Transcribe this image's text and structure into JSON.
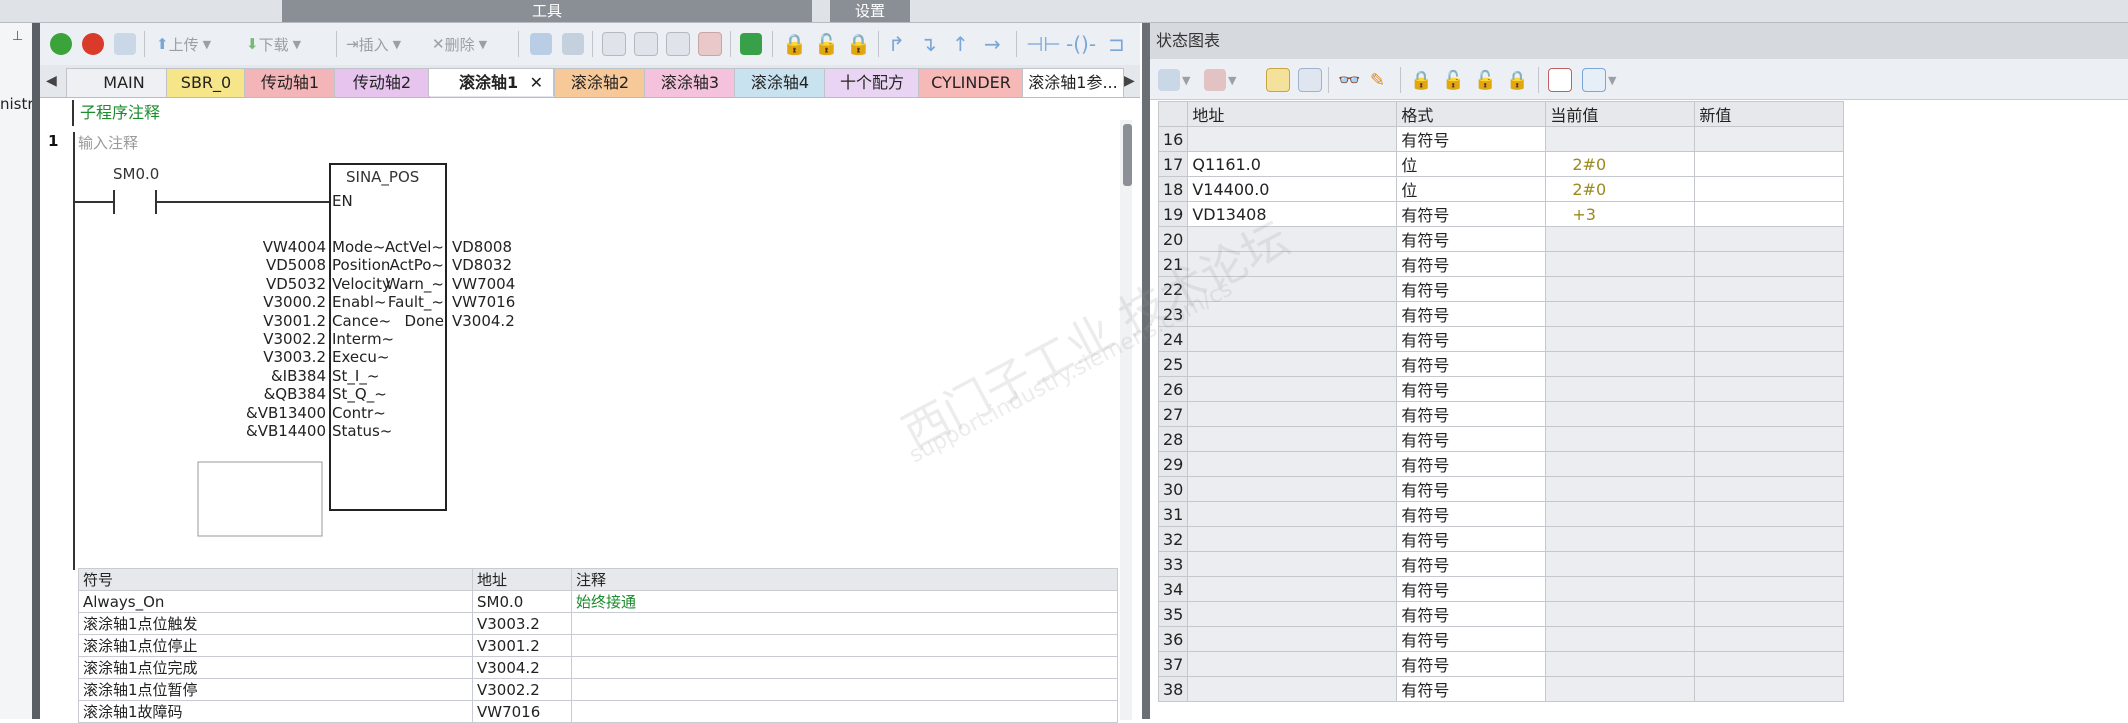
{
  "menu": {
    "tools_label": "工具",
    "settings_label": "设置"
  },
  "left": {
    "partial_text": "nistra"
  },
  "toolbar": {
    "upload_label": "上传",
    "download_label": "下载",
    "insert_label": "插入",
    "delete_label": "删除"
  },
  "tabs": [
    {
      "label": "MAIN",
      "color": "#eef0f3"
    },
    {
      "label": "SBR_0",
      "color": "#f7e58a"
    },
    {
      "label": "传动轴1",
      "color": "#f4b5b8"
    },
    {
      "label": "传动轴2",
      "color": "#e6c4ee"
    },
    {
      "label": "滚涂轴1",
      "color": "#ffffff"
    },
    {
      "label": "滚涂轴2",
      "color": "#f8c998"
    },
    {
      "label": "滚涂轴3",
      "color": "#f4c2dc"
    },
    {
      "label": "滚涂轴4",
      "color": "#c8e2ef"
    },
    {
      "label": "十个配方",
      "color": "#e9d5f3"
    },
    {
      "label": "CYLINDER",
      "color": "#f7b8b8"
    },
    {
      "label": "滚涂轴1参...",
      "color": "#ffffff"
    }
  ],
  "editor": {
    "subroutine_comment": "子程序注释",
    "network_number": "1",
    "network_comment": "输入注释",
    "contact": "SM0.0",
    "block_name": "SINA_POS",
    "en": "EN",
    "inputs": [
      {
        "value": "VW4004",
        "pin": "Mode~"
      },
      {
        "value": "VD5008",
        "pin": "Position"
      },
      {
        "value": "VD5032",
        "pin": "Velocity"
      },
      {
        "value": "V3000.2",
        "pin": "Enabl~"
      },
      {
        "value": "V3001.2",
        "pin": "Cance~"
      },
      {
        "value": "V3002.2",
        "pin": "Interm~"
      },
      {
        "value": "V3003.2",
        "pin": "Execu~"
      },
      {
        "value": "&IB384",
        "pin": "St_I_~"
      },
      {
        "value": "&QB384",
        "pin": "St_Q_~"
      },
      {
        "value": "&VB13400",
        "pin": "Contr~"
      },
      {
        "value": "&VB14400",
        "pin": "Status~"
      }
    ],
    "outputs": [
      {
        "pin": "ActVel~",
        "value": "VD8008"
      },
      {
        "pin": "ActPo~",
        "value": "VD8032"
      },
      {
        "pin": "Warn_~",
        "value": "VW7004"
      },
      {
        "pin": "Fault_~",
        "value": "VW7016"
      },
      {
        "pin": "Done",
        "value": "V3004.2"
      }
    ]
  },
  "symbols": {
    "headers": [
      "符号",
      "地址",
      "注释"
    ],
    "rows": [
      [
        "Always_On",
        "SM0.0",
        "始终接通"
      ],
      [
        "滚涂轴1点位触发",
        "V3003.2",
        ""
      ],
      [
        "滚涂轴1点位停止",
        "V3001.2",
        ""
      ],
      [
        "滚涂轴1点位完成",
        "V3004.2",
        ""
      ],
      [
        "滚涂轴1点位暂停",
        "V3002.2",
        ""
      ],
      [
        "滚涂轴1故障码",
        "VW7016",
        ""
      ]
    ]
  },
  "status_chart": {
    "title": "状态图表",
    "headers": [
      "地址",
      "格式",
      "当前值",
      "新值"
    ],
    "rows": [
      {
        "n": "16",
        "addr": "",
        "fmt": "有符号",
        "cur": ""
      },
      {
        "n": "17",
        "addr": "Q1161.0",
        "fmt": "位",
        "cur": "2#0"
      },
      {
        "n": "18",
        "addr": "V14400.0",
        "fmt": "位",
        "cur": "2#0"
      },
      {
        "n": "19",
        "addr": "VD13408",
        "fmt": "有符号",
        "cur": "+3"
      },
      {
        "n": "20",
        "addr": "",
        "fmt": "有符号",
        "cur": ""
      },
      {
        "n": "21",
        "addr": "",
        "fmt": "有符号",
        "cur": ""
      },
      {
        "n": "22",
        "addr": "",
        "fmt": "有符号",
        "cur": ""
      },
      {
        "n": "23",
        "addr": "",
        "fmt": "有符号",
        "cur": ""
      },
      {
        "n": "24",
        "addr": "",
        "fmt": "有符号",
        "cur": ""
      },
      {
        "n": "25",
        "addr": "",
        "fmt": "有符号",
        "cur": ""
      },
      {
        "n": "26",
        "addr": "",
        "fmt": "有符号",
        "cur": ""
      },
      {
        "n": "27",
        "addr": "",
        "fmt": "有符号",
        "cur": ""
      },
      {
        "n": "28",
        "addr": "",
        "fmt": "有符号",
        "cur": ""
      },
      {
        "n": "29",
        "addr": "",
        "fmt": "有符号",
        "cur": ""
      },
      {
        "n": "30",
        "addr": "",
        "fmt": "有符号",
        "cur": ""
      },
      {
        "n": "31",
        "addr": "",
        "fmt": "有符号",
        "cur": ""
      },
      {
        "n": "32",
        "addr": "",
        "fmt": "有符号",
        "cur": ""
      },
      {
        "n": "33",
        "addr": "",
        "fmt": "有符号",
        "cur": ""
      },
      {
        "n": "34",
        "addr": "",
        "fmt": "有符号",
        "cur": ""
      },
      {
        "n": "35",
        "addr": "",
        "fmt": "有符号",
        "cur": ""
      },
      {
        "n": "36",
        "addr": "",
        "fmt": "有符号",
        "cur": ""
      },
      {
        "n": "37",
        "addr": "",
        "fmt": "有符号",
        "cur": ""
      },
      {
        "n": "38",
        "addr": "",
        "fmt": "有符号",
        "cur": ""
      }
    ]
  },
  "watermark": {
    "text": "西门子工业 技术论坛",
    "url_text": "support.industry.siemens.com/cs"
  }
}
